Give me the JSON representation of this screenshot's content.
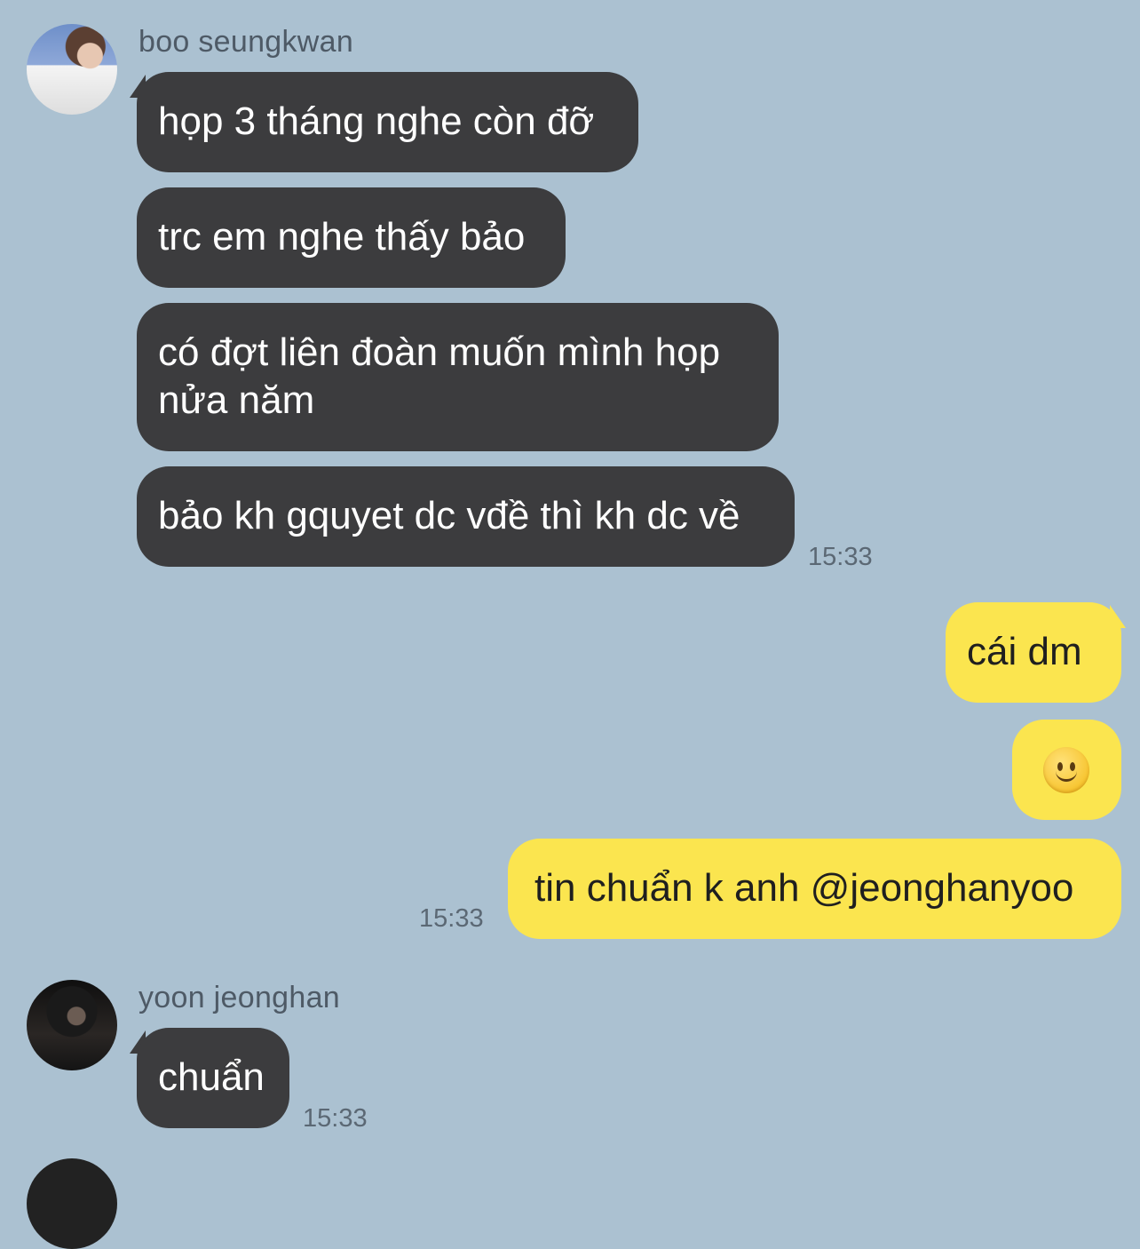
{
  "messages": {
    "group1": {
      "sender": "boo seungkwan",
      "avatar_icon": "profile-photo-icon",
      "bubbles": [
        "họp 3 tháng nghe còn đỡ",
        "trc em nghe thấy bảo",
        "có đợt liên đoàn muốn mình họp nửa năm",
        "bảo kh gquyet dc vđề thì kh dc về"
      ],
      "time": "15:33"
    },
    "group2": {
      "sender_is_me": true,
      "bubbles": [
        "cái dm",
        "🙂",
        "tin chuẩn k anh @jeonghanyoo"
      ],
      "time": "15:33"
    },
    "group3": {
      "sender": "yoon jeonghan",
      "avatar_icon": "profile-photo-icon",
      "bubbles": [
        "chuẩn"
      ],
      "time": "15:33"
    }
  },
  "colors": {
    "background": "#abc1d1",
    "incoming_bubble": "#3c3c3e",
    "outgoing_bubble": "#fbe54f"
  }
}
